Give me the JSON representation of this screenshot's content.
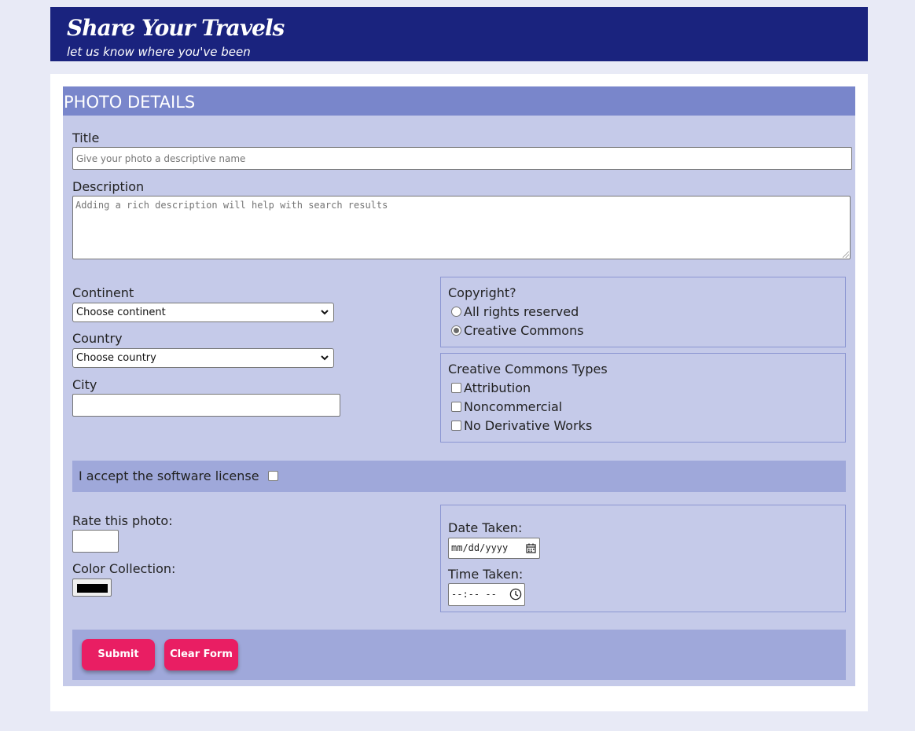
{
  "header": {
    "title": "Share Your Travels",
    "tagline": "let us know where you've been"
  },
  "form": {
    "heading": "PHOTO DETAILS",
    "title_field": {
      "label": "Title",
      "placeholder": "Give your photo a descriptive name",
      "value": ""
    },
    "description_field": {
      "label": "Description",
      "placeholder": "Adding a rich description will help with search results",
      "value": ""
    },
    "continent": {
      "label": "Continent",
      "selected": "Choose continent"
    },
    "country": {
      "label": "Country",
      "selected": "Choose country"
    },
    "city": {
      "label": "City",
      "value": ""
    },
    "copyright": {
      "legend": "Copyright?",
      "options": [
        {
          "label": "All rights reserved",
          "checked": false
        },
        {
          "label": "Creative Commons",
          "checked": true
        }
      ]
    },
    "cc_types": {
      "legend": "Creative Commons Types",
      "options": [
        {
          "label": "Attribution",
          "checked": false
        },
        {
          "label": "Noncommercial",
          "checked": false
        },
        {
          "label": "No Derivative Works",
          "checked": false
        }
      ]
    },
    "license": {
      "label": "I accept the software license",
      "checked": false
    },
    "rating": {
      "label": "Rate this photo:",
      "value": ""
    },
    "color": {
      "label": "Color Collection:",
      "value": "#000000"
    },
    "date_taken": {
      "label": "Date Taken:",
      "placeholder": "mm/dd/yyyy"
    },
    "time_taken": {
      "label": "Time Taken:",
      "placeholder": "--:-- --"
    },
    "buttons": {
      "submit": "Submit",
      "clear": "Clear Form"
    }
  },
  "colors": {
    "banner": "#1a237e",
    "page_bg": "#e8eaf6",
    "panel": "#c5cae9",
    "heading_bar": "#7986cb",
    "band": "#9fa8da",
    "button": "#e91e63"
  },
  "icons": {
    "select_arrow": "chevron-down-icon",
    "date": "calendar-icon",
    "time": "clock-icon"
  }
}
